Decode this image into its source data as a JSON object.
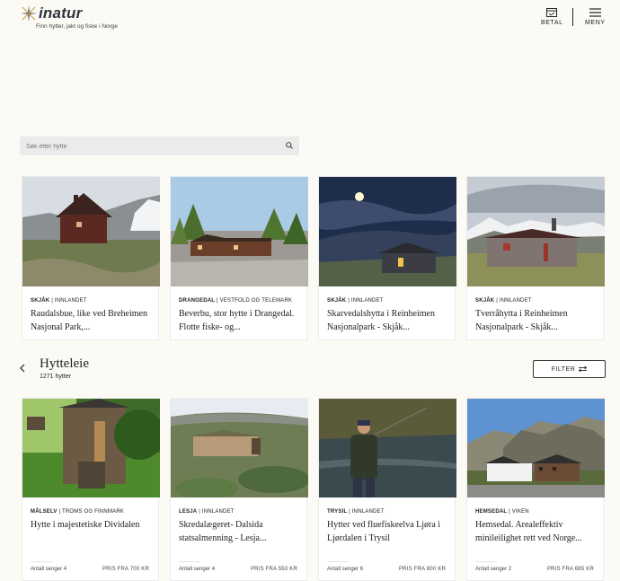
{
  "header": {
    "logo_text": "inatur",
    "tagline": "Finn hytter, jakt og fiske i Norge",
    "pay_label": "BETAL",
    "menu_label": "MENY"
  },
  "search": {
    "placeholder": "Søk etter hytte"
  },
  "featured": [
    {
      "region": "SKJÅK",
      "county": "INNLANDET",
      "title": "Raudalsbue, like ved Breheimen Nasjonal Park,..."
    },
    {
      "region": "DRANGEDAL",
      "county": "VESTFOLD OG TELEMARK",
      "title": "Beverbu, stor hytte i Drangedal. Flotte fiske- og..."
    },
    {
      "region": "SKJÅK",
      "county": "INNLANDET",
      "title": "Skarvedalshytta i Reinheimen Nasjonalpark - Skjåk..."
    },
    {
      "region": "SKJÅK",
      "county": "INNLANDET",
      "title": "Tverråhytta i Reinheimen Nasjonalpark - Skjåk..."
    }
  ],
  "section": {
    "title": "Hytteleie",
    "count": "1271 hytter",
    "filter_label": "FILTER"
  },
  "listings": [
    {
      "region": "MÅLSELV",
      "county": "TROMS OG FINNMARK",
      "title": "Hytte i majestetiske Dividalen",
      "beds": "Antall senger 4",
      "price": "PRIS FRA 700 KR"
    },
    {
      "region": "LESJA",
      "county": "INNLANDET",
      "title": "Skredalægeret- Dalsida statsalmenning - Lesja...",
      "beds": "Antall senger 4",
      "price": "PRIS FRA 550 KR"
    },
    {
      "region": "TRYSIL",
      "county": "INNLANDET",
      "title": "Hytter ved fluefiskeelva Ljøra i Ljørdalen i Trysil",
      "beds": "Antall senger 6",
      "price": "PRIS FRA 800 KR"
    },
    {
      "region": "HEMSEDAL",
      "county": "VIKEN",
      "title": "Hemsedal. Arealeffektiv minileilighet rett ved Norge...",
      "beds": "Antall senger 2",
      "price": "PRIS FRA 685 KR"
    }
  ],
  "colors": {
    "background": "#fbfaf4",
    "text": "#1a1a1a",
    "search_bg": "#ebebeb"
  },
  "icons": [
    "logo-star-icon",
    "card-icon",
    "hamburger-icon",
    "search-icon",
    "chevron-left-icon",
    "filter-sliders-icon"
  ]
}
